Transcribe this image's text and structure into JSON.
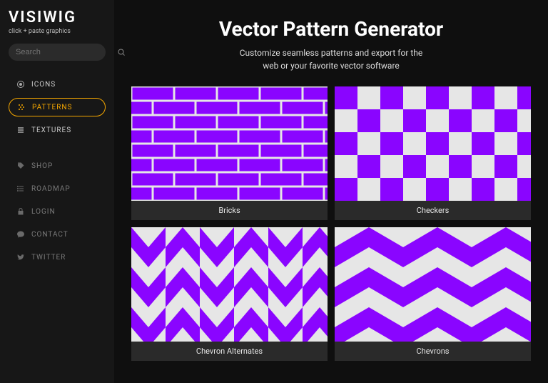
{
  "brand": {
    "name": "VISIWIG",
    "tagline": "click + paste graphics"
  },
  "search": {
    "placeholder": "Search"
  },
  "nav_primary": [
    {
      "label": "ICONS",
      "icon": "circle-target-icon",
      "active": false
    },
    {
      "label": "PATTERNS",
      "icon": "pattern-dots-icon",
      "active": true
    },
    {
      "label": "TEXTURES",
      "icon": "texture-bars-icon",
      "active": false
    }
  ],
  "nav_secondary": [
    {
      "label": "SHOP",
      "icon": "tag-icon"
    },
    {
      "label": "ROADMAP",
      "icon": "list-icon"
    },
    {
      "label": "LOGIN",
      "icon": "lock-icon"
    },
    {
      "label": "CONTACT",
      "icon": "speech-bubble-icon"
    },
    {
      "label": "TWITTER",
      "icon": "twitter-icon"
    }
  ],
  "page": {
    "title": "Vector Pattern Generator",
    "subtitle": "Customize seamless patterns and export for the\nweb or your favorite vector software"
  },
  "colors": {
    "accent": "#8A05FF",
    "accent_gold": "#f5a700",
    "pattern_bg": "#e6e6e6"
  },
  "patterns": [
    {
      "id": "bricks",
      "caption": "Bricks"
    },
    {
      "id": "checkers",
      "caption": "Checkers"
    },
    {
      "id": "chevron_alt",
      "caption": "Chevron Alternates"
    },
    {
      "id": "chevrons",
      "caption": "Chevrons"
    }
  ]
}
